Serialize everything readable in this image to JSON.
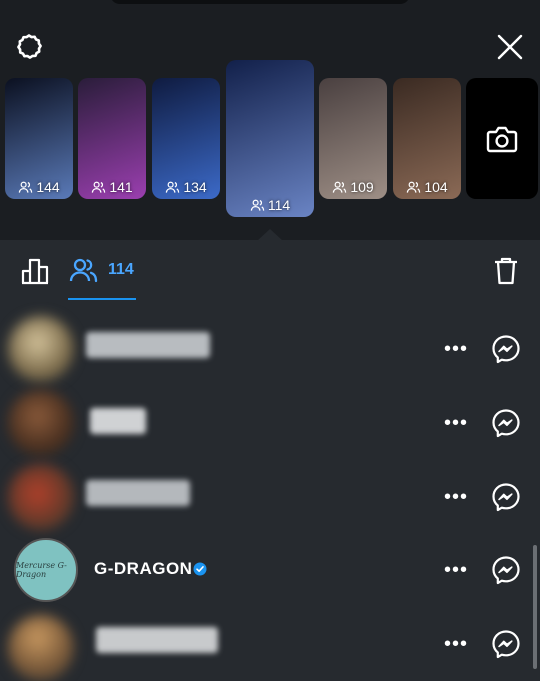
{
  "header": {
    "settings_icon": "gear-icon",
    "close_icon": "close-icon"
  },
  "stories": [
    {
      "viewers": "144",
      "colors": [
        "#0b1020",
        "#5a7ab8"
      ]
    },
    {
      "viewers": "141",
      "colors": [
        "#2a1d3a",
        "#9b3fb0"
      ]
    },
    {
      "viewers": "134",
      "colors": [
        "#0f1b40",
        "#3c6ac8"
      ]
    },
    {
      "viewers": "114",
      "colors": [
        "#12204a",
        "#6a84c4"
      ],
      "selected": true
    },
    {
      "viewers": "109",
      "colors": [
        "#4a4040",
        "#9e8f86"
      ]
    },
    {
      "viewers": "104",
      "colors": [
        "#3a2a22",
        "#8b6a56"
      ]
    }
  ],
  "camera_icon": "camera-icon",
  "tabs": {
    "insights_icon": "bar-chart-icon",
    "viewers_icon": "users-icon",
    "viewers_count": "114",
    "delete_icon": "trash-icon"
  },
  "viewers": [
    {
      "name": "",
      "redacted": true
    },
    {
      "name": "",
      "redacted": true
    },
    {
      "name": "",
      "redacted": true
    },
    {
      "name": "G-DRAGON",
      "verified": true,
      "avatar_text": "Mercurse G-Dragon"
    },
    {
      "name": "",
      "redacted": true
    }
  ],
  "row_actions": {
    "more_label": "•••",
    "message_icon": "messenger-icon"
  },
  "colors": {
    "accent": "#1a93f0",
    "background": "#262a2f",
    "header_bg": "#1b1e22"
  }
}
